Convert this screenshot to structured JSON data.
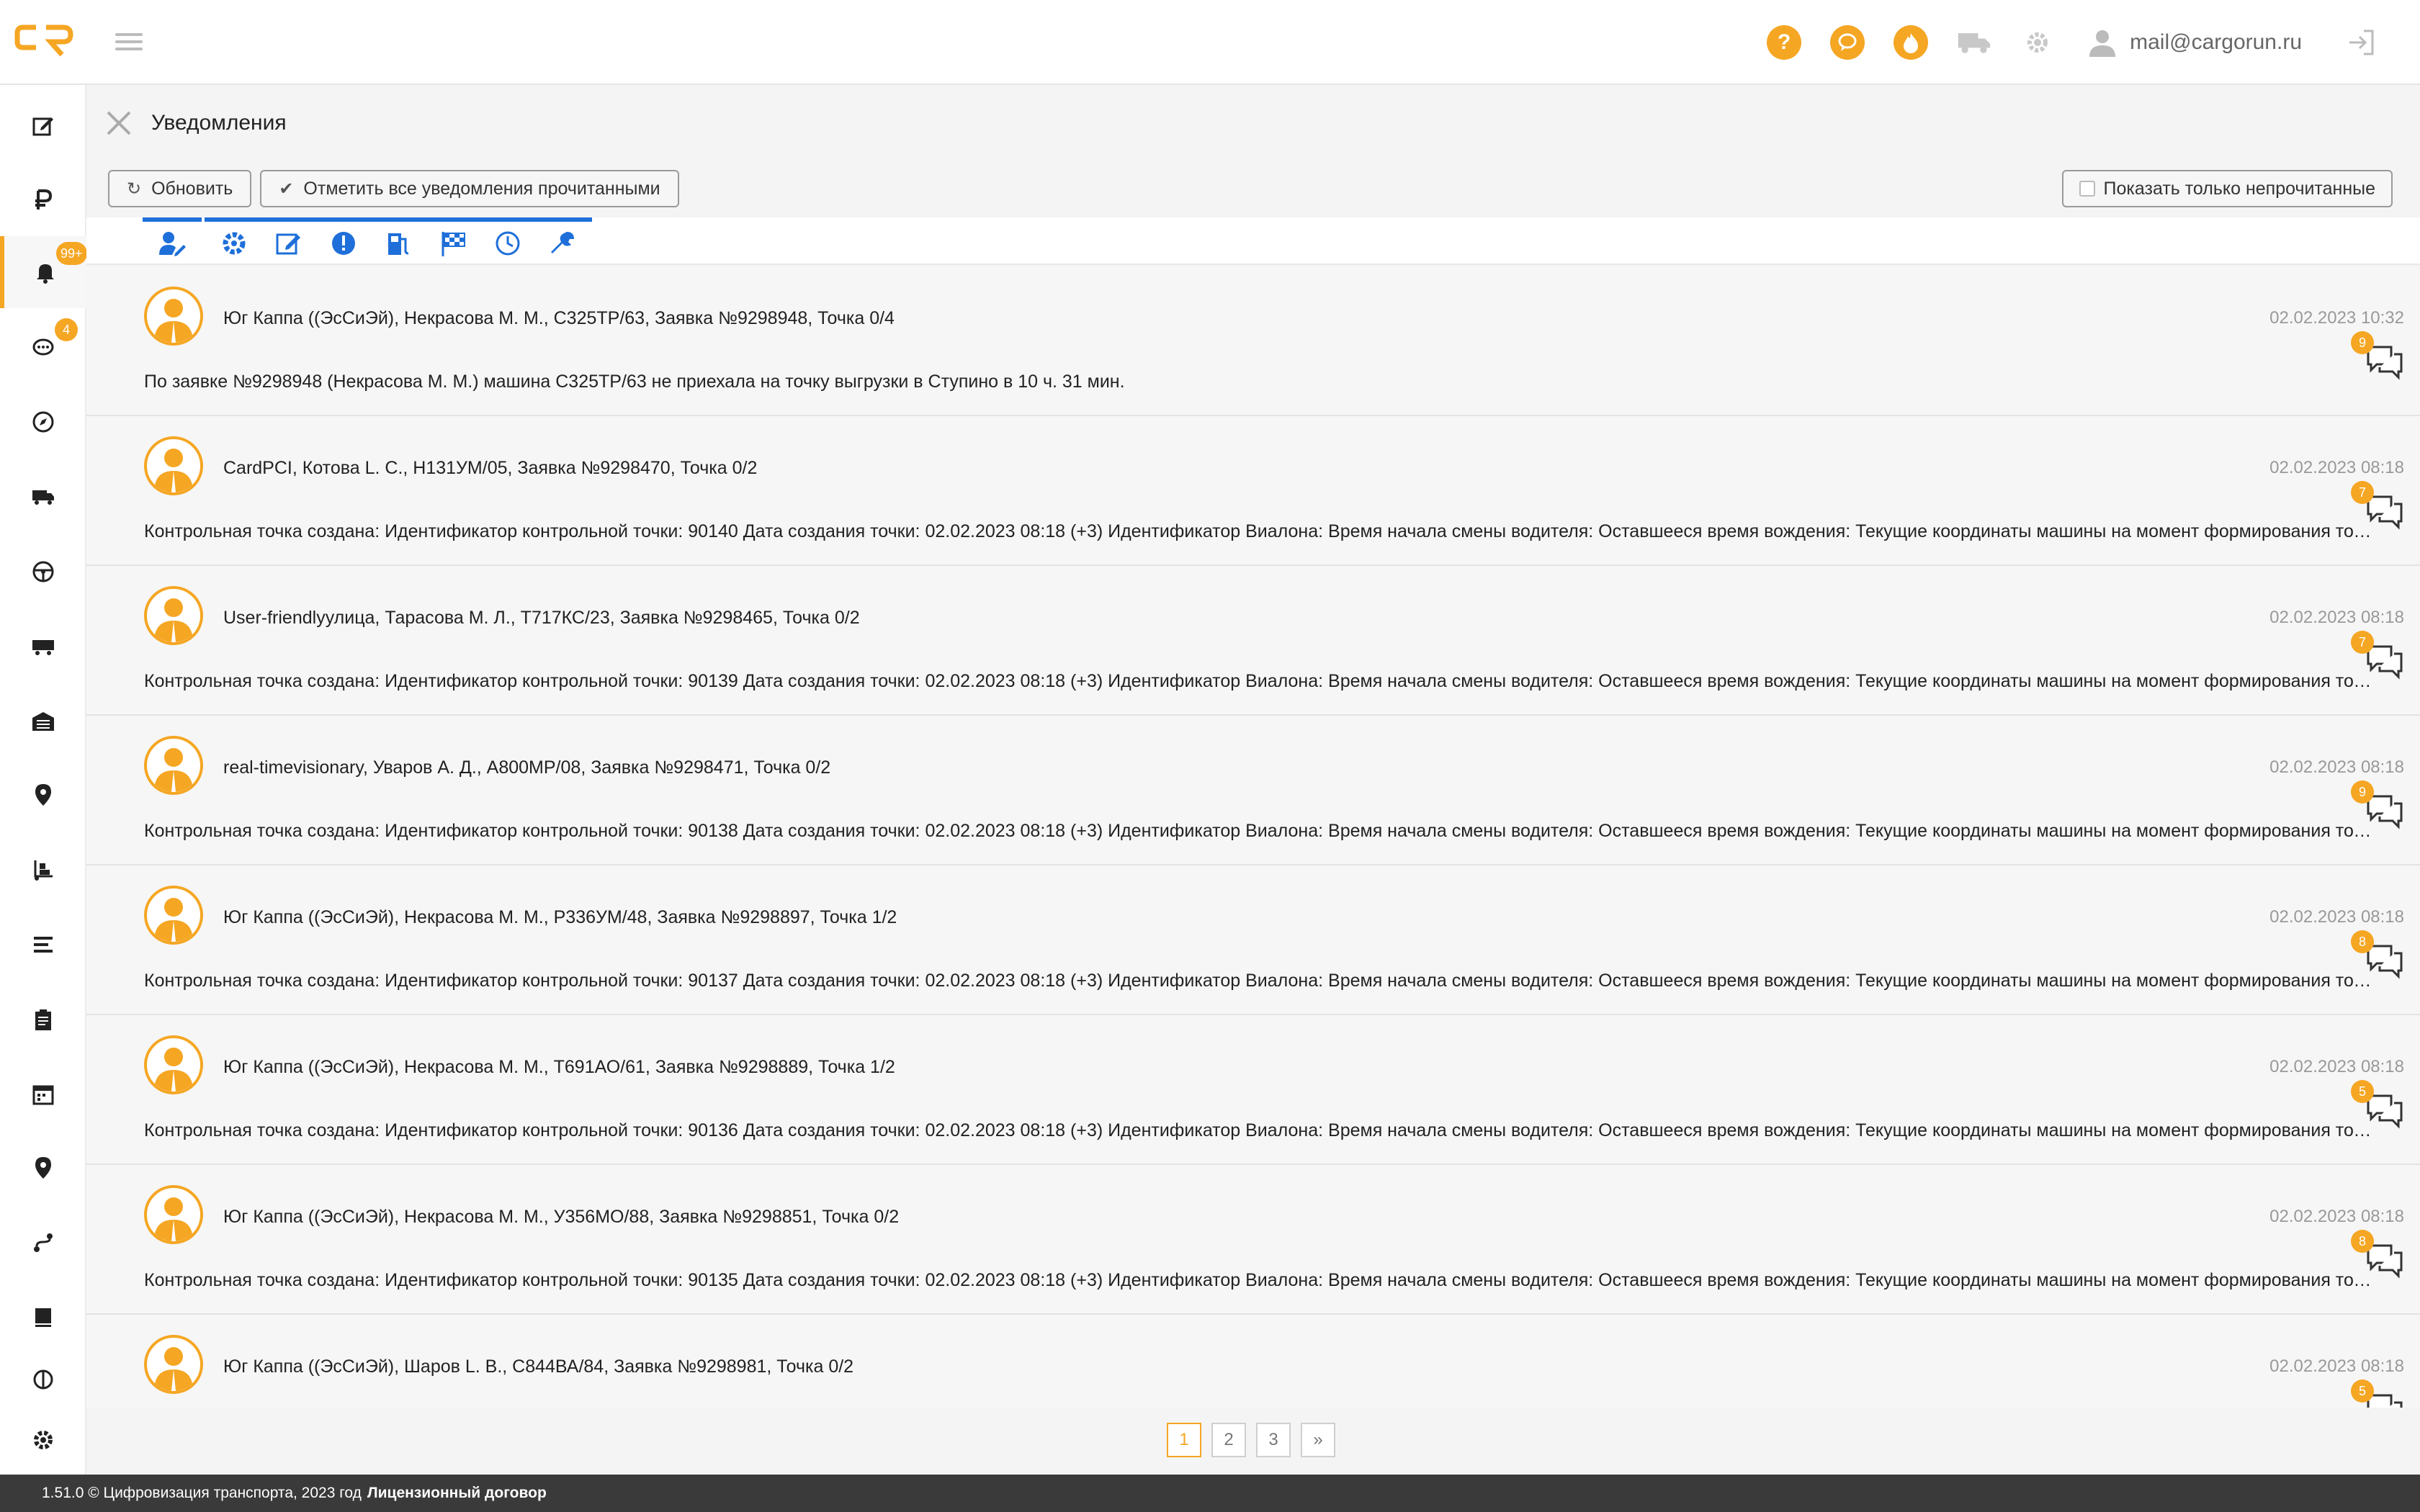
{
  "app": {
    "user_email": "mail@cargorun.ru",
    "accent_color": "#f5a623",
    "filter_color": "#1e6fd9"
  },
  "page": {
    "title": "Уведомления"
  },
  "toolbar": {
    "refresh_label": "Обновить",
    "mark_all_label": "Отметить все уведомления прочитанными",
    "show_unread_label": "Показать только непрочитанные"
  },
  "sidebar": {
    "notifications_badge": "99+",
    "messages_badge": "4"
  },
  "notifications": [
    {
      "title": "Юг Каппа ((ЭсСиЭй), Некрасова М. М., С325ТР/63, Заявка №9298948, Точка 0/4",
      "date": "02.02.2023 10:32",
      "body": "По заявке №9298948 (Некрасова М. М.) машина С325ТР/63 не приехала на точку выгрузки в Ступино в 10 ч. 31 мин.",
      "comments": "9"
    },
    {
      "title": "CardPCI, Котова L. С., Н131УМ/05, Заявка №9298470, Точка 0/2",
      "date": "02.02.2023 08:18",
      "body": "Контрольная точка создана: Идентификатор контрольной точки: 90140 Дата создания точки: 02.02.2023 08:18 (+3) Идентификатор Виалона: Время начала смены водителя: Оставшееся время вождения: Текущие координаты машины на момент формирования точки:",
      "comments": "7"
    },
    {
      "title": "User-friendlyулица, Тарасова М. Л., Т717КС/23, Заявка №9298465, Точка 0/2",
      "date": "02.02.2023 08:18",
      "body": "Контрольная точка создана: Идентификатор контрольной точки: 90139 Дата создания точки: 02.02.2023 08:18 (+3) Идентификатор Виалона: Время начала смены водителя: Оставшееся время вождения: Текущие координаты машины на момент формирования точки:",
      "comments": "7"
    },
    {
      "title": "real-timevisionary, Уваров А. Д., А800МР/08, Заявка №9298471, Точка 0/2",
      "date": "02.02.2023 08:18",
      "body": "Контрольная точка создана: Идентификатор контрольной точки: 90138 Дата создания точки: 02.02.2023 08:18 (+3) Идентификатор Виалона: Время начала смены водителя: Оставшееся время вождения: Текущие координаты машины на момент формирования точки:",
      "comments": "9"
    },
    {
      "title": "Юг Каппа ((ЭсСиЭй), Некрасова М. М., Р336УМ/48, Заявка №9298897, Точка 1/2",
      "date": "02.02.2023 08:18",
      "body": "Контрольная точка создана: Идентификатор контрольной точки: 90137 Дата создания точки: 02.02.2023 08:18 (+3) Идентификатор Виалона: Время начала смены водителя: Оставшееся время вождения: Текущие координаты машины на момент формирования точки:",
      "comments": "8"
    },
    {
      "title": "Юг Каппа ((ЭсСиЭй), Некрасова М. М., Т691АО/61, Заявка №9298889, Точка 1/2",
      "date": "02.02.2023 08:18",
      "body": "Контрольная точка создана: Идентификатор контрольной точки: 90136 Дата создания точки: 02.02.2023 08:18 (+3) Идентификатор Виалона: Время начала смены водителя: Оставшееся время вождения: Текущие координаты машины на момент формирования точки:",
      "comments": "5"
    },
    {
      "title": "Юг Каппа ((ЭсСиЭй), Некрасова М. М., У356МО/88, Заявка №9298851, Точка 0/2",
      "date": "02.02.2023 08:18",
      "body": "Контрольная точка создана: Идентификатор контрольной точки: 90135 Дата создания точки: 02.02.2023 08:18 (+3) Идентификатор Виалона: Время начала смены водителя: Оставшееся время вождения: Текущие координаты машины на момент формирования точки:",
      "comments": "8"
    },
    {
      "title": "Юг Каппа ((ЭсСиЭй), Шаров L. В., С844ВА/84, Заявка №9298981, Точка 0/2",
      "date": "02.02.2023 08:18",
      "body": "",
      "comments": "5"
    }
  ],
  "pagination": {
    "pages": [
      "1",
      "2",
      "3"
    ],
    "next": "»",
    "current": "1"
  },
  "footer": {
    "version_text": "1.51.0 © Цифровизация транспорта, 2023 год",
    "license_link": "Лицензионный договор"
  }
}
